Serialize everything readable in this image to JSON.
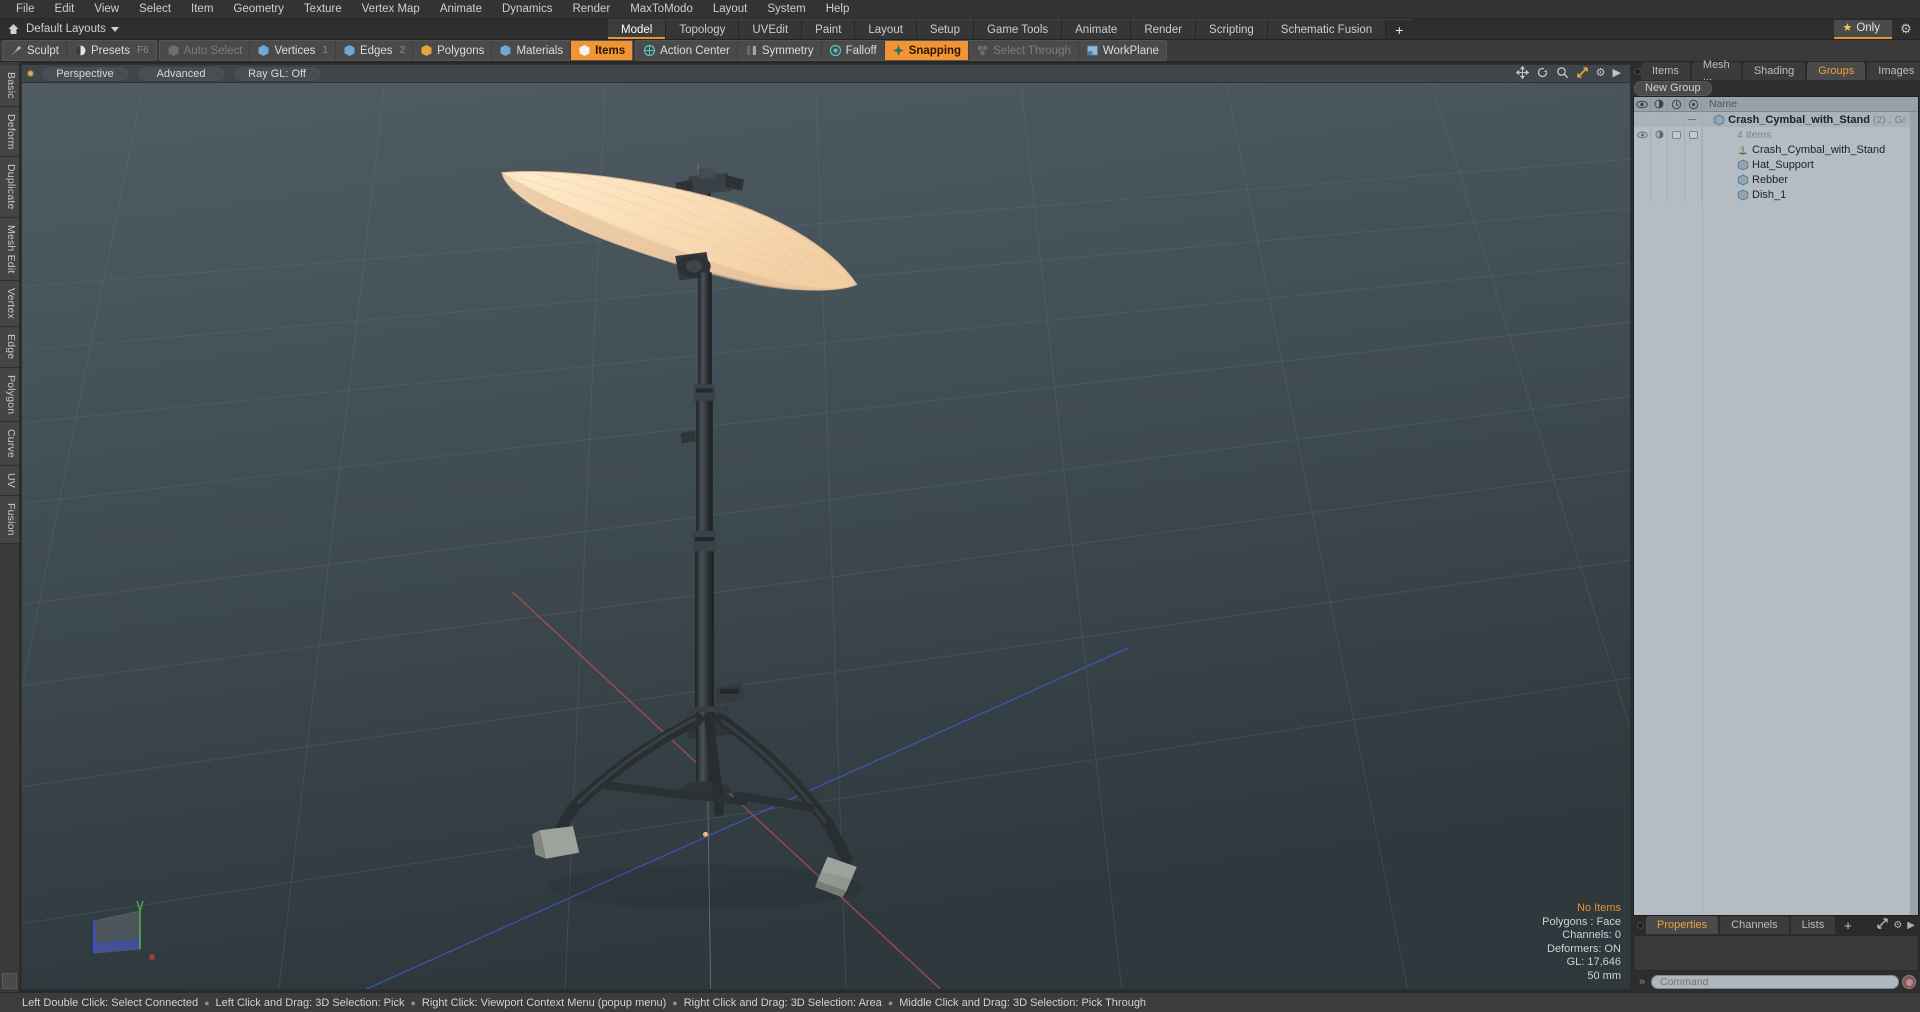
{
  "menubar": {
    "items": [
      "File",
      "Edit",
      "View",
      "Select",
      "Item",
      "Geometry",
      "Texture",
      "Vertex Map",
      "Animate",
      "Dynamics",
      "Render",
      "MaxToModo",
      "Layout",
      "System",
      "Help"
    ]
  },
  "layoutbar": {
    "home_icon": "home-icon",
    "layouts_label": "Default Layouts",
    "tabs": [
      {
        "label": "Model",
        "active": true
      },
      {
        "label": "Topology",
        "active": false
      },
      {
        "label": "UVEdit",
        "active": false
      },
      {
        "label": "Paint",
        "active": false
      },
      {
        "label": "Layout",
        "active": false
      },
      {
        "label": "Setup",
        "active": false
      },
      {
        "label": "Game Tools",
        "active": false
      },
      {
        "label": "Animate",
        "active": false
      },
      {
        "label": "Render",
        "active": false
      },
      {
        "label": "Scripting",
        "active": false
      },
      {
        "label": "Schematic Fusion",
        "active": false
      }
    ],
    "add_tab_label": "+",
    "only_label": "Only",
    "gear_label": "⚙"
  },
  "toolbar": {
    "group1": [
      {
        "label": "Sculpt",
        "icon": "brush-icon",
        "state": "normal"
      },
      {
        "label": "Presets",
        "icon": "sphere-icon",
        "state": "normal",
        "shortcut": "F6"
      }
    ],
    "group2": [
      {
        "label": "Auto Select",
        "icon": "cube-grey-icon",
        "state": "dim"
      },
      {
        "label": "Vertices",
        "icon": "cube-blue-icon",
        "state": "normal",
        "num": "1"
      },
      {
        "label": "Edges",
        "icon": "cube-blue-icon",
        "state": "normal",
        "num": "2"
      },
      {
        "label": "Polygons",
        "icon": "cube-orange-icon",
        "state": "normal",
        "num": ""
      },
      {
        "label": "Materials",
        "icon": "cube-blue-icon",
        "state": "normal",
        "num": ""
      },
      {
        "label": "Items",
        "icon": "cube-white-icon",
        "state": "on",
        "num": ""
      }
    ],
    "group3": [
      {
        "label": "Action Center",
        "icon": "globe-icon",
        "state": "normal"
      },
      {
        "label": "Symmetry",
        "icon": "mirror-icon",
        "state": "normal"
      },
      {
        "label": "Falloff",
        "icon": "target-icon",
        "state": "normal"
      },
      {
        "label": "Snapping",
        "icon": "snap-icon",
        "state": "on"
      },
      {
        "label": "Select Through",
        "icon": "through-icon",
        "state": "dim"
      },
      {
        "label": "WorkPlane",
        "icon": "plane-icon",
        "state": "normal"
      }
    ]
  },
  "left_tabs": [
    "Basic",
    "Deform",
    "Duplicate",
    "Mesh Edit",
    "Vertex",
    "Edge",
    "Polygon",
    "Curve",
    "UV",
    "Fusion"
  ],
  "viewport": {
    "view_mode": "Perspective",
    "shading_mode": "Advanced",
    "raygl": "Ray GL: Off",
    "header_icons": [
      "move-icon",
      "rotate-icon",
      "zoom-icon",
      "fit-icon",
      "gear-icon",
      "chevron-right-icon"
    ],
    "stats": {
      "selection": "No Items",
      "polygons": "Polygons : Face",
      "channels": "Channels: 0",
      "deformers": "Deformers: ON",
      "gl": "GL: 17,646",
      "focal": "50 mm"
    },
    "axis_colors": {
      "x": "#c0504d",
      "y": "#4f9a4f",
      "z": "#4a5fc4"
    },
    "model_color": "#f5d8b0",
    "stand_color": "#32383c"
  },
  "right_panel": {
    "tabs": [
      {
        "label": "Items",
        "active": false
      },
      {
        "label": "Mesh ...",
        "active": false
      },
      {
        "label": "Shading",
        "active": false
      },
      {
        "label": "Groups",
        "active": true
      },
      {
        "label": "Images",
        "active": false
      }
    ],
    "add_tab_label": "+",
    "new_group_label": "New Group",
    "tree_header": {
      "name_col": "Name",
      "col_icons": [
        "eye-icon",
        "render-icon",
        "lock-icon",
        "select-icon"
      ]
    },
    "tree": [
      {
        "type": "group",
        "name": "Crash_Cymbal_with_Stand",
        "count": "(2)",
        "meta": ": Gr ...",
        "bold": true
      },
      {
        "type": "info",
        "name": "4 Items"
      },
      {
        "type": "item",
        "name": "Crash_Cymbal_with_Stand",
        "icon": "locator-icon"
      },
      {
        "type": "item",
        "name": "Hat_Support",
        "icon": "mesh-icon"
      },
      {
        "type": "item",
        "name": "Rebber",
        "icon": "mesh-icon"
      },
      {
        "type": "item",
        "name": "Dish_1",
        "icon": "mesh-icon"
      }
    ]
  },
  "bottom_panel": {
    "tabs": [
      {
        "label": "Properties",
        "active": true
      },
      {
        "label": "Channels",
        "active": false
      },
      {
        "label": "Lists",
        "active": false
      }
    ],
    "add_tab_label": "+"
  },
  "command": {
    "placeholder": "Command",
    "value": "",
    "arrow": "»"
  },
  "statusbar": {
    "segments": [
      "Left Double Click: Select Connected",
      "Left Click and Drag: 3D Selection: Pick",
      "Right Click: Viewport Context Menu (popup menu)",
      "Right Click and Drag: 3D Selection: Area",
      "Middle Click and Drag: 3D Selection: Pick Through"
    ],
    "separator": "●"
  }
}
